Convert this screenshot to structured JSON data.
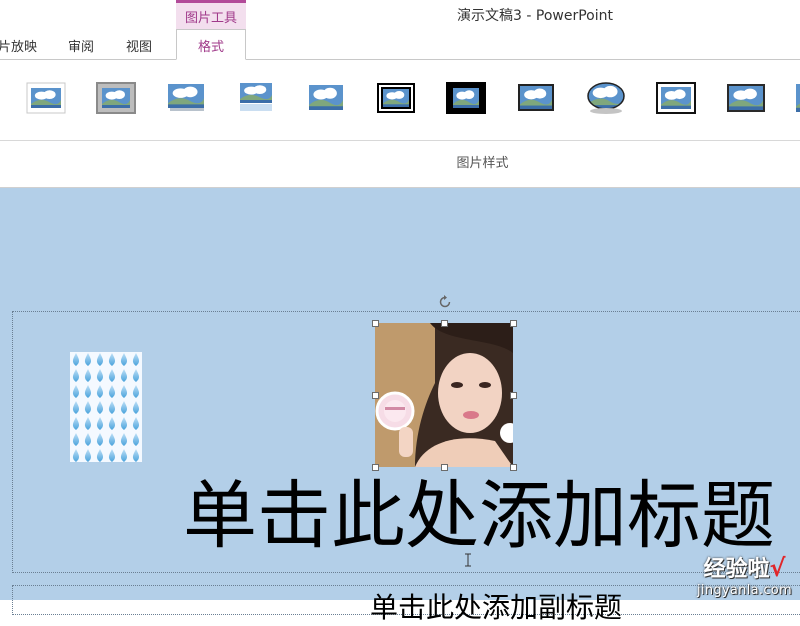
{
  "app": {
    "title": "演示文稿3 - PowerPoint"
  },
  "context_tab_group": {
    "label": "图片工具"
  },
  "tabs": [
    {
      "label": "片放映"
    },
    {
      "label": "审阅"
    },
    {
      "label": "视图"
    },
    {
      "label": "格式",
      "active": true
    }
  ],
  "ribbon": {
    "group_label": "图片样式",
    "styles": [
      {
        "icon": "picture-style-simple-frame-icon"
      },
      {
        "icon": "picture-style-thick-matte-gray-icon"
      },
      {
        "icon": "picture-style-drop-shadow-rect-icon"
      },
      {
        "icon": "picture-style-reflected-rect-icon"
      },
      {
        "icon": "picture-style-soft-edge-rect-icon"
      },
      {
        "icon": "picture-style-double-frame-black-icon"
      },
      {
        "icon": "picture-style-thick-black-frame-icon"
      },
      {
        "icon": "picture-style-simple-shadow-icon"
      },
      {
        "icon": "picture-style-reflected-oval-icon"
      },
      {
        "icon": "picture-style-metal-frame-icon"
      },
      {
        "icon": "picture-style-center-shadow-icon"
      },
      {
        "icon": "picture-style-partial-icon"
      }
    ]
  },
  "slide": {
    "background": "#b3cfe8",
    "title_placeholder": "单击此处添加标题",
    "subtitle_placeholder": "单击此处添加副标题"
  },
  "watermark": {
    "brand": "经验啦",
    "check": "√",
    "url": "jingyanla.com"
  },
  "colors": {
    "accent": "#a03a8a",
    "context_bg": "#f3dfee"
  }
}
